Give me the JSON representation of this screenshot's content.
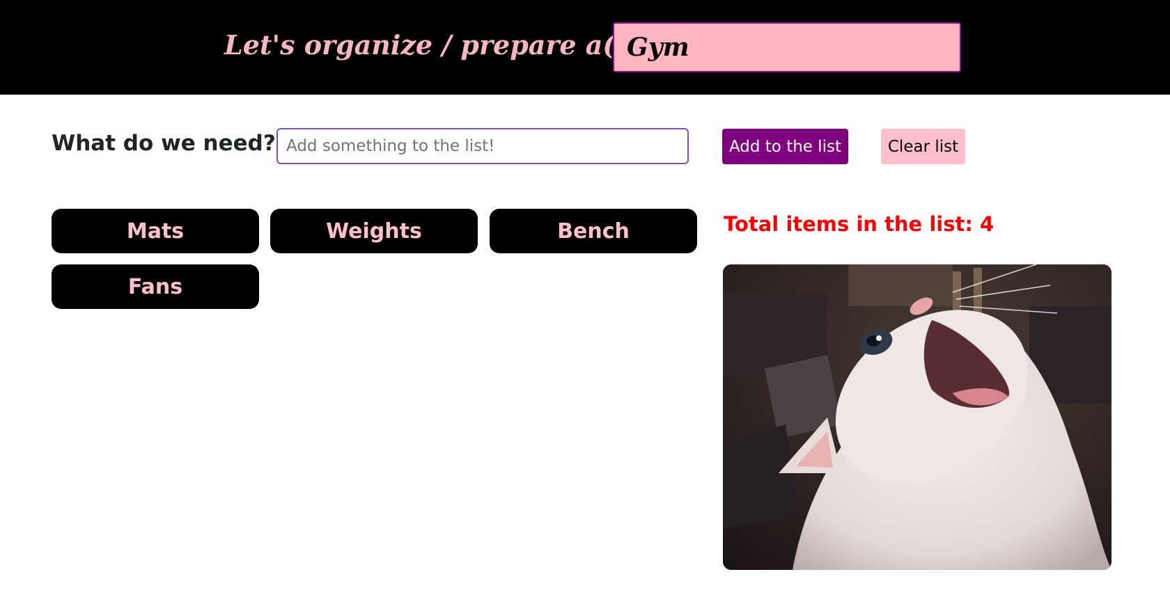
{
  "header": {
    "title": "Let's organize / prepare a(n):",
    "event_value": "Gym"
  },
  "form": {
    "label": "What do we need?",
    "input_placeholder": "Add something to the list!",
    "input_value": "",
    "add_button": "Add to the list",
    "clear_button": "Clear list"
  },
  "items": [
    {
      "label": "Mats"
    },
    {
      "label": "Weights"
    },
    {
      "label": "Bench"
    },
    {
      "label": "Fans"
    }
  ],
  "summary": {
    "total_text": "Total items in the list: 4"
  },
  "colors": {
    "header_bg": "#000000",
    "header_text": "#f7b6c2",
    "event_input_bg": "#ffb6c1",
    "add_button_bg": "#800080",
    "clear_button_bg": "#ffc0cb",
    "chip_bg": "#000000",
    "chip_text": "#ffc0cb",
    "total_text": "#ff0000"
  }
}
